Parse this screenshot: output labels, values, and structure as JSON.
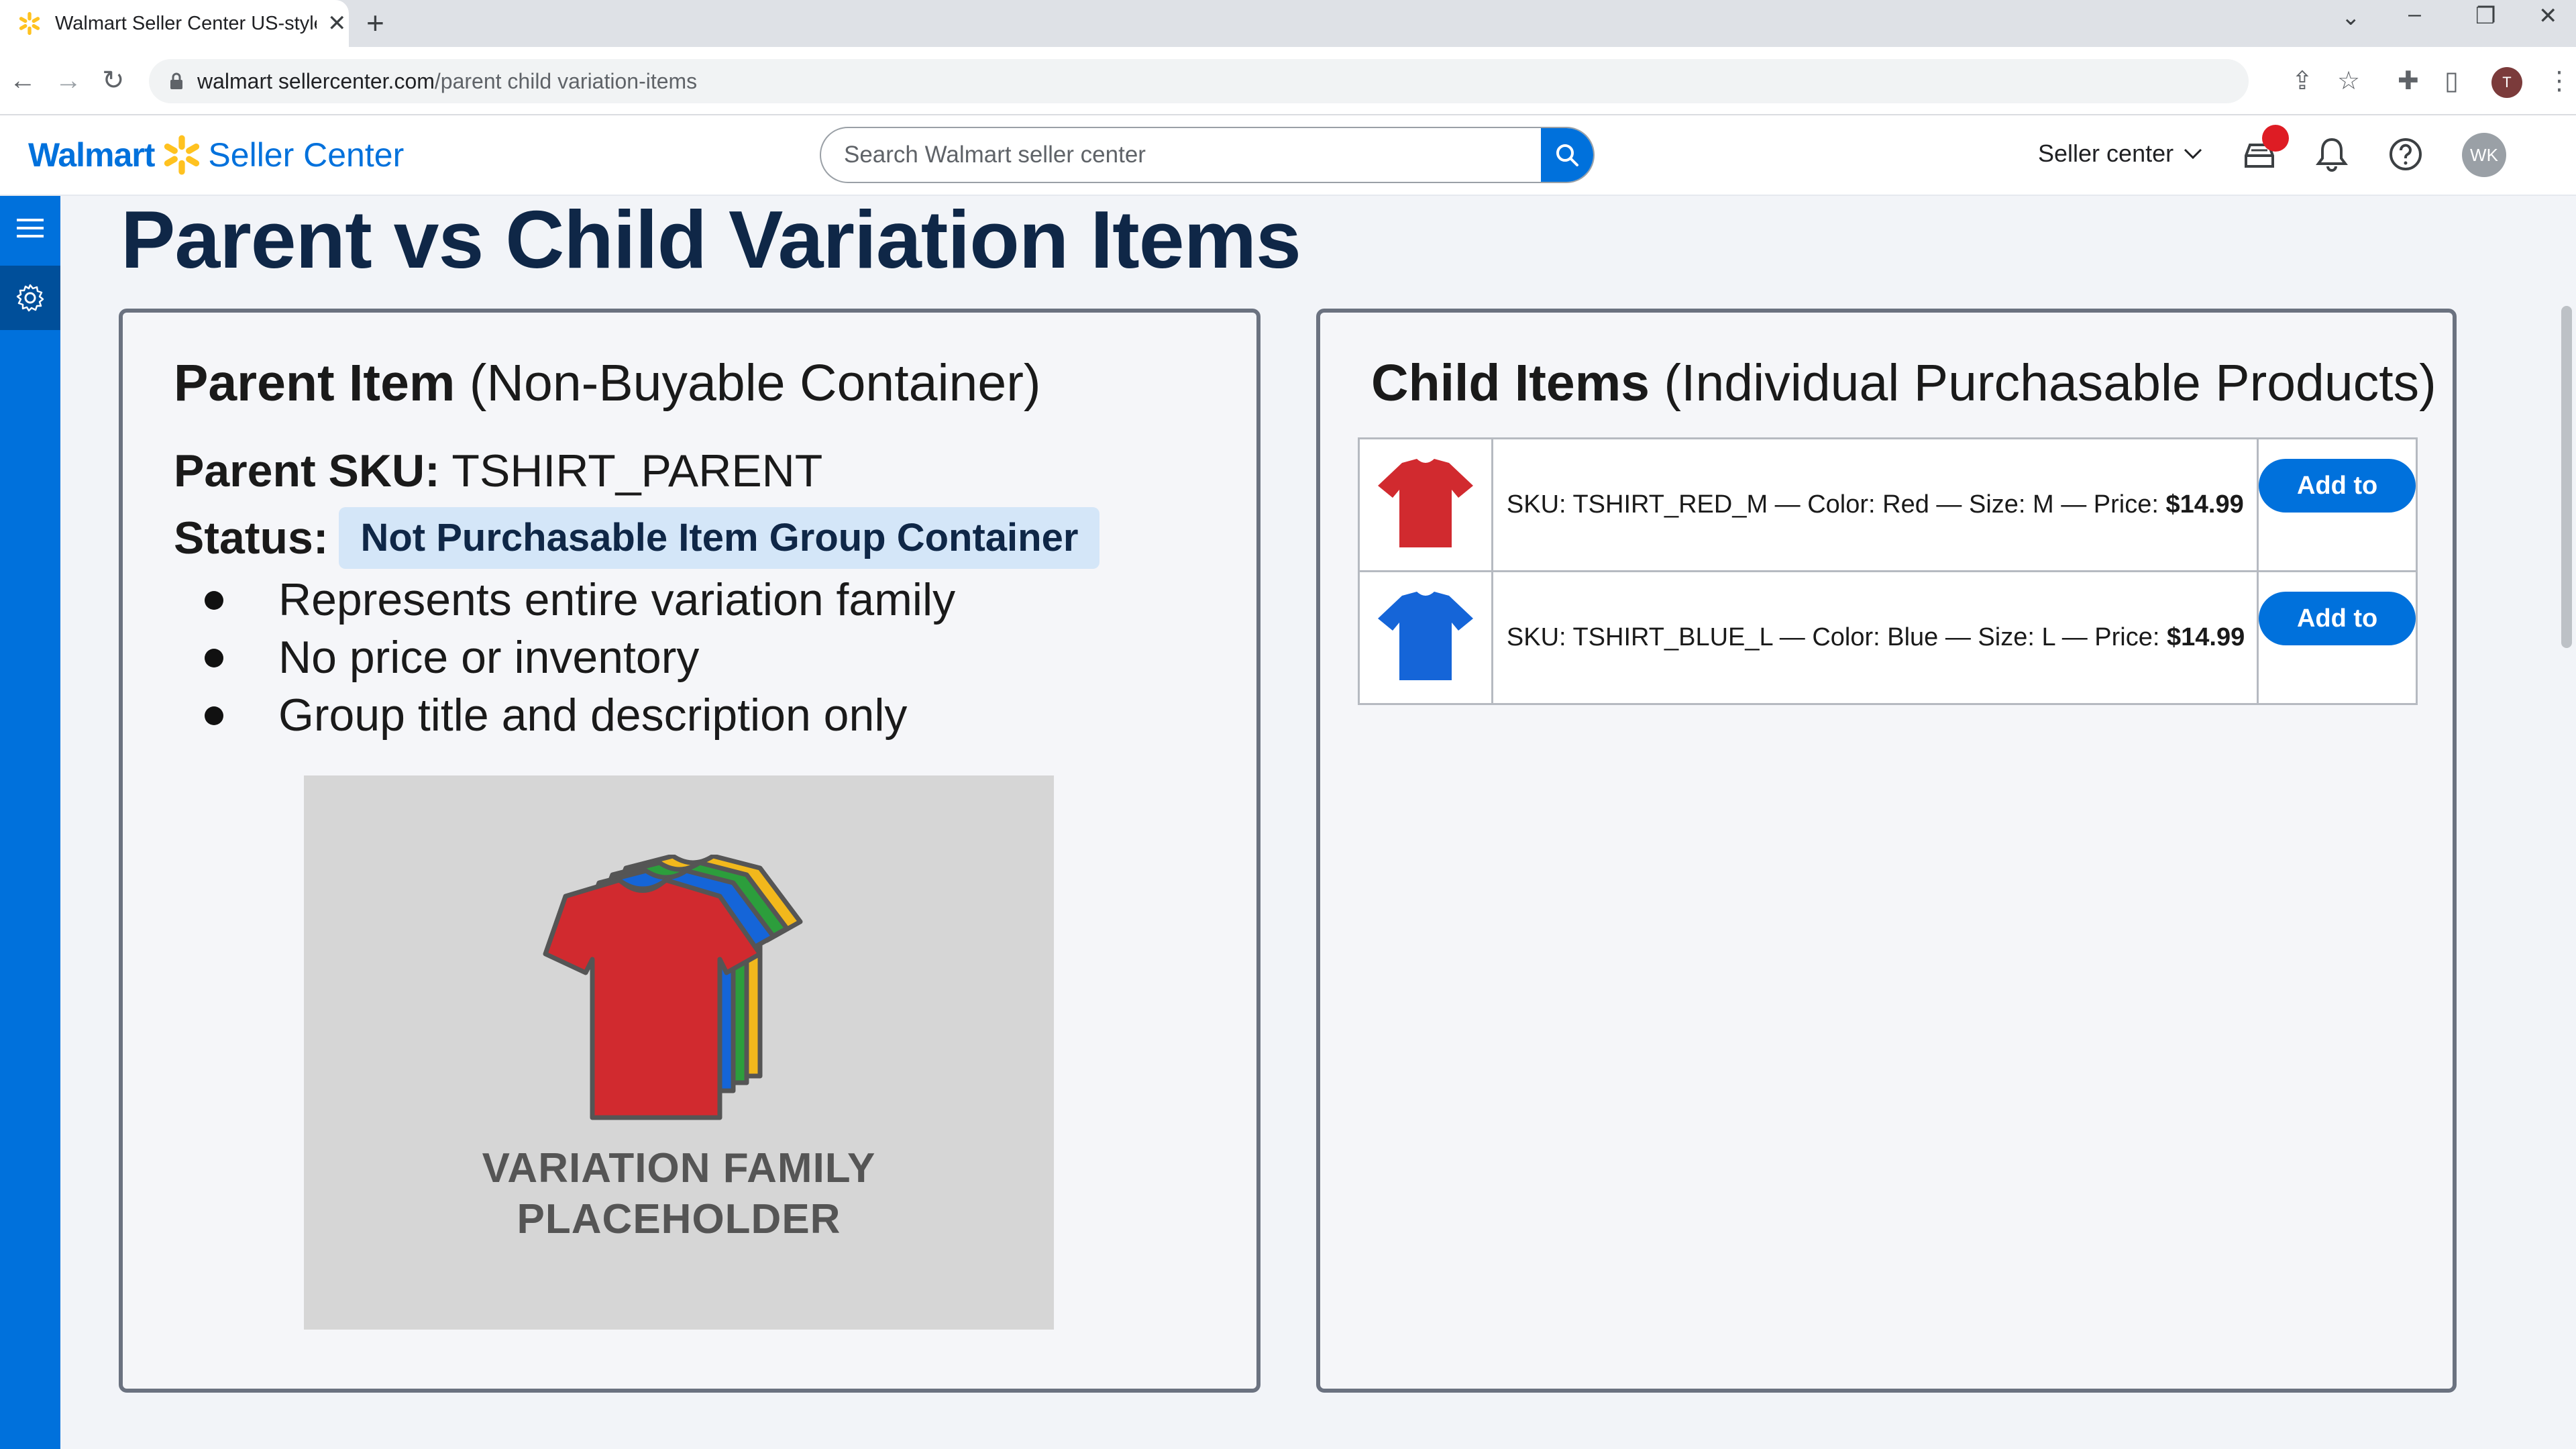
{
  "browser": {
    "tab_title": "Walmart Seller Center US-style",
    "url_host": "walmart sellercenter.com",
    "url_path": "/parent child variation-items",
    "profile_initial": "T"
  },
  "header": {
    "logo_brand": "Walmart",
    "logo_product": "Seller Center",
    "search_placeholder": "Search Walmart seller center",
    "seller_dropdown": "Seller center",
    "avatar_initials": "WK"
  },
  "page": {
    "title": "Parent vs Child Variation Items"
  },
  "parent_panel": {
    "heading_bold": "Parent Item",
    "heading_rest": "(Non-Buyable Container)",
    "sku_label": "Parent SKU:",
    "sku_value": "TSHIRT_PARENT",
    "status_label": "Status:",
    "status_value": "Not Purchasable Item Group Container",
    "bullets": [
      "Represents entire variation family",
      "No price or inventory",
      "Group title and description only"
    ],
    "placeholder_line1": "VARIATION FAMILY",
    "placeholder_line2": "PLACEHOLDER"
  },
  "child_panel": {
    "heading_bold": "Child Items",
    "heading_rest": "(Individual Purchasable Products)",
    "items": [
      {
        "desc": "SKU: TSHIRT_RED_M — Color: Red — Size: M — Price: ",
        "price": "$14.99",
        "button": "Add to Cart",
        "color": "#d12a2f"
      },
      {
        "desc": "SKU: TSHIRT_BLUE_L — Color: Blue — Size: L — Price: ",
        "price": "$14.99",
        "button": "Add to Cart",
        "color": "#1565d8"
      }
    ]
  },
  "colors": {
    "brand_blue": "#0071dc",
    "spark_yellow": "#ffc220",
    "title_navy": "#0f2747",
    "badge_red": "#de1c24"
  }
}
